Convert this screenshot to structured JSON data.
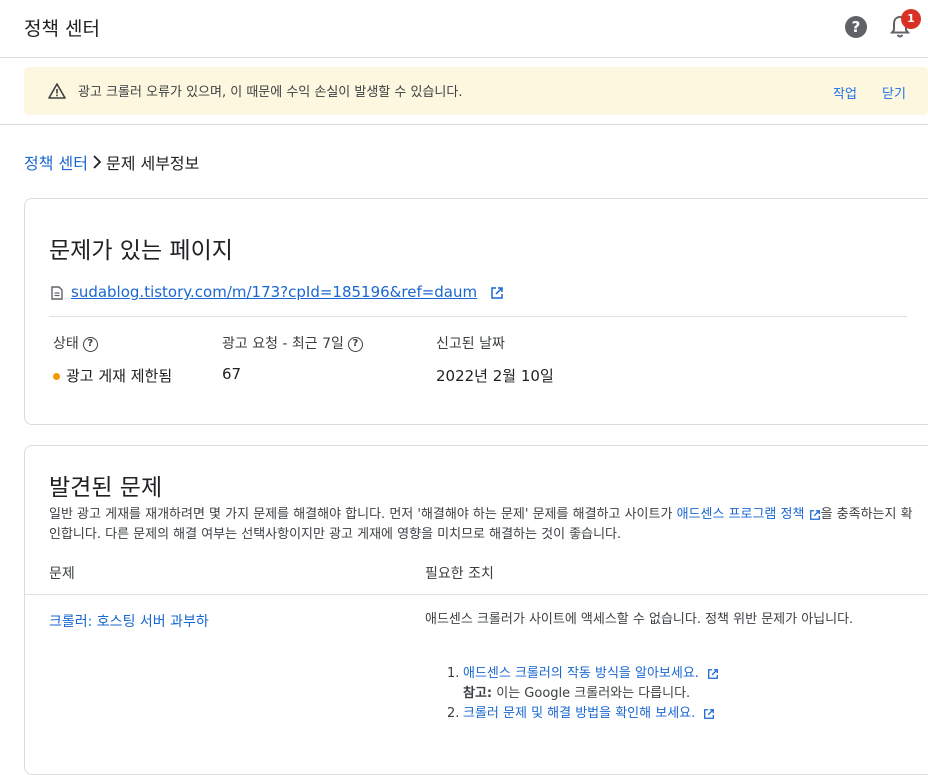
{
  "header": {
    "title": "정책 센터",
    "notification_count": "1",
    "help_icon": "help-circle-icon",
    "bell_icon": "bell-icon"
  },
  "banner": {
    "icon": "warning-icon",
    "message": "광고 크롤러 오류가 있으며, 이 때문에 수익 손실이 발생할 수 있습니다.",
    "action_label": "작업",
    "dismiss_label": "닫기"
  },
  "breadcrumb": {
    "parent": "정책 센터",
    "current": "문제 세부정보"
  },
  "page_card": {
    "title": "문제가 있는 페이지",
    "url": "sudablog.tistory.com/m/173?cpId=185196&ref=daum",
    "status_label": "상태",
    "status_value": "광고 게재 제한됨",
    "requests_label": "광고 요청 - 최근 7일",
    "requests_value": "67",
    "reported_label": "신고된 날짜",
    "reported_value": "2022년 2월 10일"
  },
  "issues_card": {
    "title": "발견된 문제",
    "description_part1": "일반 광고 게재를 재개하려면 몇 가지 문제를 해결해야 합니다. 먼저 '해결해야 하는 문제' 문제를 해결하고 사이트가 ",
    "description_link": "애드센스 프로그램 정책",
    "description_part2": "을 충족하는지 확인합니다. 다른 문제의 해결 여부는 선택사항이지만 광고 게재에 영향을 미치므로 해결하는 것이 좋습니다.",
    "col_issue": "문제",
    "col_action": "필요한 조치",
    "issue_name": "크롤러: 호스팅 서버 과부하",
    "action_text": "애드센스 크롤러가 사이트에 액세스할 수 없습니다. 정책 위반 문제가 아닙니다.",
    "steps": [
      {
        "num": "1.",
        "link": "애드센스 크롤러의 작동 방식을 알아보세요."
      },
      {
        "num": "2.",
        "link": "크롤러 문제 및 해결 방법을 확인해 보세요."
      }
    ],
    "note_label": "참고:",
    "note_text": " 이는 Google 크롤러와는 다릅니다."
  }
}
